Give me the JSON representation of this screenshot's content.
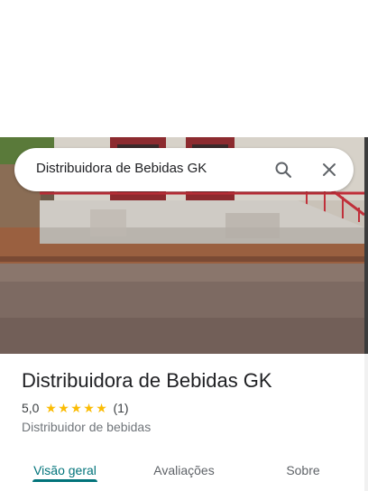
{
  "search": {
    "query": "Distribuidora de Bebidas GK",
    "search_icon": "search-icon",
    "close_icon": "close-icon"
  },
  "photo": {
    "subject": "storefront-photo"
  },
  "place": {
    "name": "Distribuidora de Bebidas GK",
    "rating": "5,0",
    "stars": 5,
    "review_count": "(1)",
    "category": "Distribuidor de bebidas"
  },
  "tabs": [
    {
      "label": "Visão geral",
      "active": true
    },
    {
      "label": "Avaliações",
      "active": false
    },
    {
      "label": "Sobre",
      "active": false
    }
  ],
  "colors": {
    "accent": "#01737a",
    "star": "#fbbc04"
  }
}
